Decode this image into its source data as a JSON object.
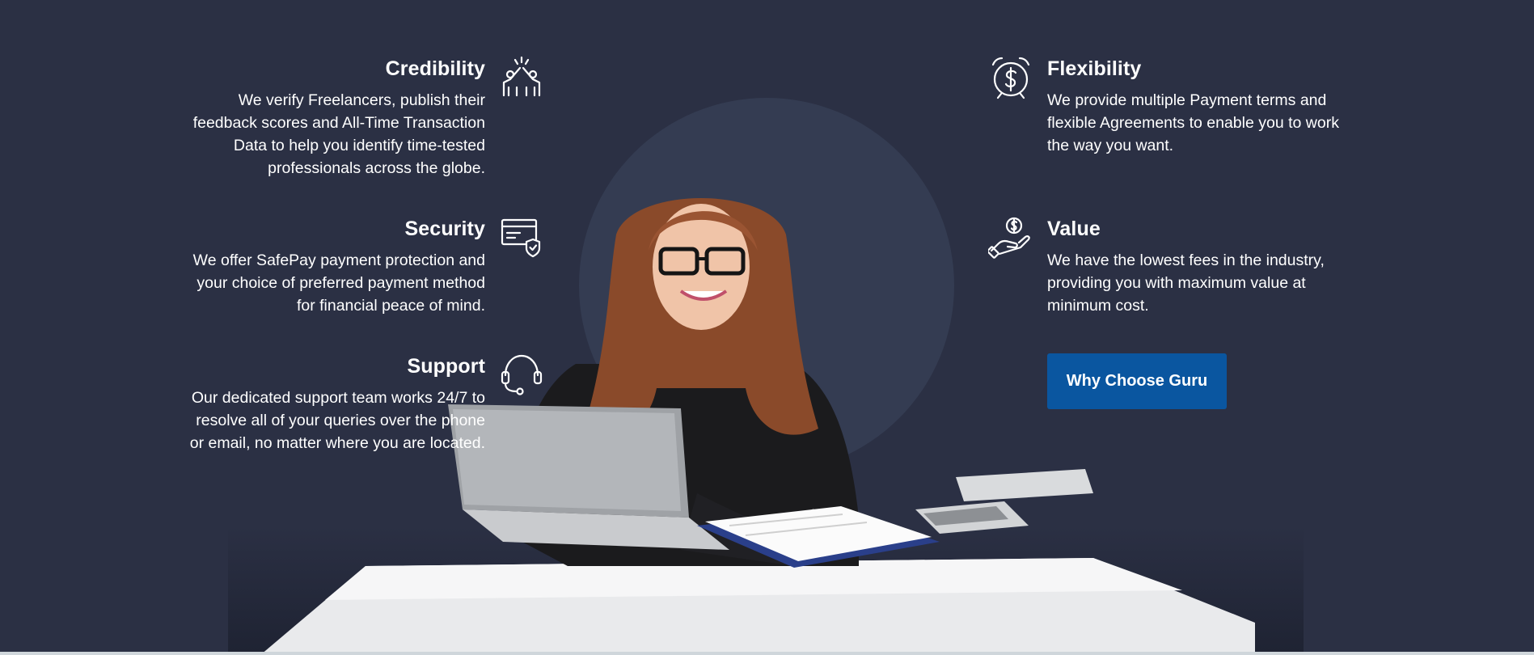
{
  "features_left": [
    {
      "title": "Credibility",
      "icon": "high-five-icon",
      "lines": [
        "We verify Freelancers, publish their",
        "feedback scores and All-Time Transaction",
        "Data to help you identify time-tested",
        "professionals across the globe."
      ]
    },
    {
      "title": "Security",
      "icon": "secure-card-icon",
      "lines": [
        "We offer SafePay payment protection and",
        "your choice of preferred payment method",
        "for financial peace of mind."
      ]
    },
    {
      "title": "Support",
      "icon": "headset-icon",
      "lines": [
        "Our dedicated support team works 24/7 to",
        "resolve all of your queries over the phone",
        "or email, no matter where you are located."
      ]
    }
  ],
  "features_right": [
    {
      "title": "Flexibility",
      "icon": "dollar-clock-icon",
      "lines": [
        "We provide multiple Payment terms and",
        "flexible Agreements to enable you to work",
        "the way you want."
      ]
    },
    {
      "title": "Value",
      "icon": "hand-coin-icon",
      "lines": [
        "We have the lowest fees in the industry,",
        "providing you with maximum value at",
        "minimum cost."
      ]
    }
  ],
  "cta": {
    "label": "Why Choose Guru"
  },
  "colors": {
    "background": "#2b3044",
    "halo": "#343c52",
    "button": "#0a56a0"
  }
}
